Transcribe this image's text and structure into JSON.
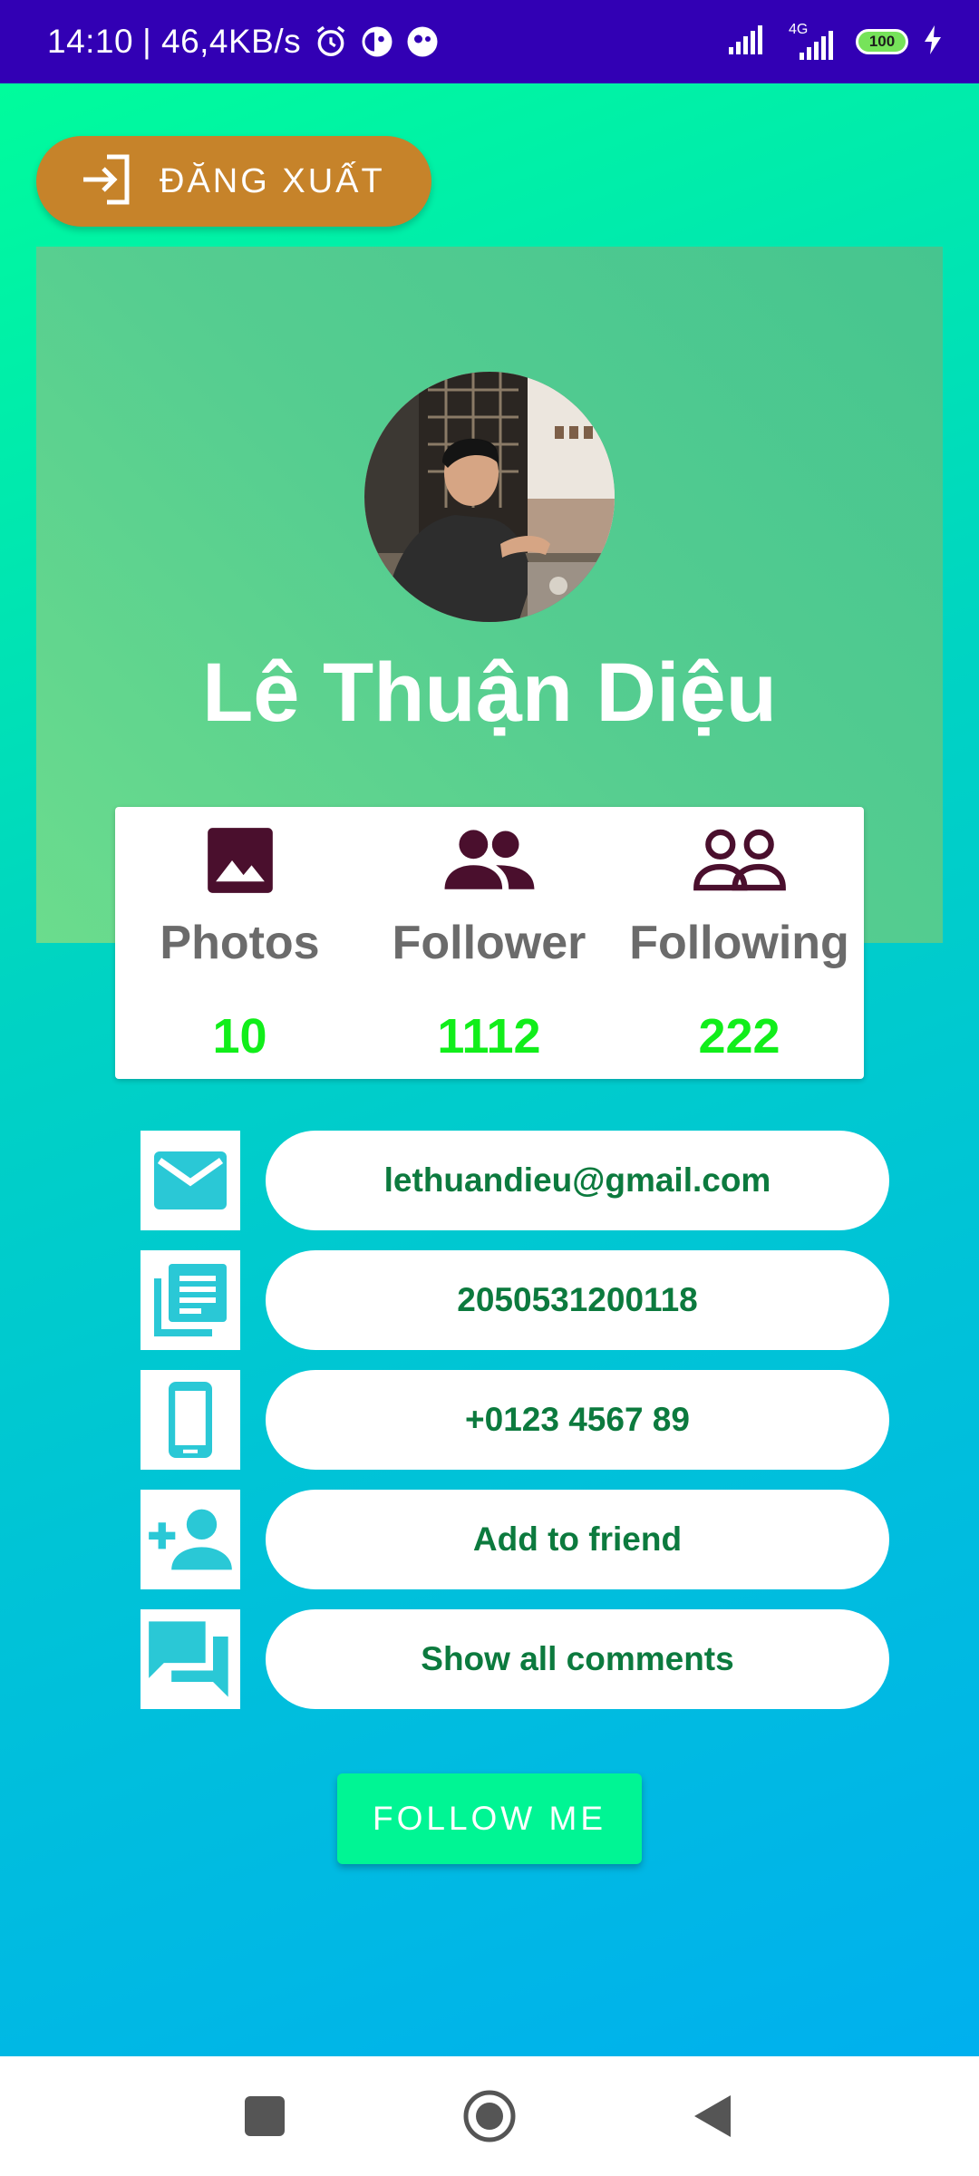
{
  "status_bar": {
    "time": "14:10",
    "speed": "| 46,4KB/s",
    "network": "4G",
    "battery": "100",
    "icons": [
      "alarm-icon",
      "app-notification-icon",
      "app-notification-icon",
      "signal-icon",
      "signal-4g-icon",
      "battery-icon",
      "charging-icon"
    ]
  },
  "header": {
    "logout_label": "ĐĂNG XUẤT",
    "logout_icon": "login-arrow-icon"
  },
  "profile": {
    "name": "Lê Thuận Diệu",
    "avatar": "profile-photo"
  },
  "stats": [
    {
      "label": "Photos",
      "value": "10",
      "icon": "image-icon"
    },
    {
      "label": "Follower",
      "value": "1112",
      "icon": "group-icon"
    },
    {
      "label": "Following",
      "value": "222",
      "icon": "group-outline-icon"
    }
  ],
  "info": [
    {
      "text": "lethuandieu@gmail.com",
      "icon": "mail-icon"
    },
    {
      "text": "2050531200118",
      "icon": "library-books-icon"
    },
    {
      "text": "+0123 4567 89",
      "icon": "phone-icon"
    },
    {
      "text": "Add to friend",
      "icon": "person-add-icon"
    },
    {
      "text": "Show all comments",
      "icon": "forum-icon"
    }
  ],
  "follow_label": "FOLLOW ME",
  "nav": [
    "recents-icon",
    "home-icon",
    "back-icon"
  ],
  "colors": {
    "status_bar": "#3200b4",
    "logout_button": "#c6832a",
    "stat_value": "#11ee1a",
    "info_text": "#0c7a3e",
    "icon_teal": "#2ac8d6",
    "stat_icon": "#4a0f2d",
    "follow_button": "#00f594"
  }
}
